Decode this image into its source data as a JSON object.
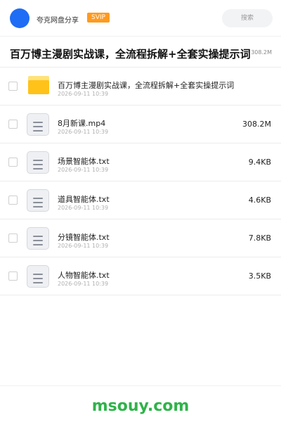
{
  "header": {
    "app_title": "夸克网盘分享",
    "badge": "SVIP",
    "search_placeholder": "搜索"
  },
  "folder": {
    "title": "百万博主漫剧实战课，全流程拆解+全套实操提示词",
    "size": "308.2M"
  },
  "files": [
    {
      "name": "百万博主漫剧实战课，全流程拆解+全套实操提示词",
      "date": "2026-09-11 10:39",
      "size": "",
      "icon": "folder-icon"
    },
    {
      "name": "8月新课.mp4",
      "date": "2026-09-11 10:39",
      "size": "308.2M",
      "icon": "file-icon"
    },
    {
      "name": "场景智能体.txt",
      "date": "2026-09-11 10:39",
      "size": "9.4KB",
      "icon": "file-icon"
    },
    {
      "name": "道具智能体.txt",
      "date": "2026-09-11 10:39",
      "size": "4.6KB",
      "icon": "file-icon"
    },
    {
      "name": "分镜智能体.txt",
      "date": "2026-09-11 10:39",
      "size": "7.8KB",
      "icon": "file-icon"
    },
    {
      "name": "人物智能体.txt",
      "date": "2026-09-11 10:39",
      "size": "3.5KB",
      "icon": "file-icon"
    }
  ],
  "footer": {
    "watermark": "msouy.com"
  },
  "colors": {
    "avatar": "#1f6cf5",
    "badge": "#ff9a1f",
    "folder": "#ffc21a",
    "watermark": "#2fb34a"
  }
}
